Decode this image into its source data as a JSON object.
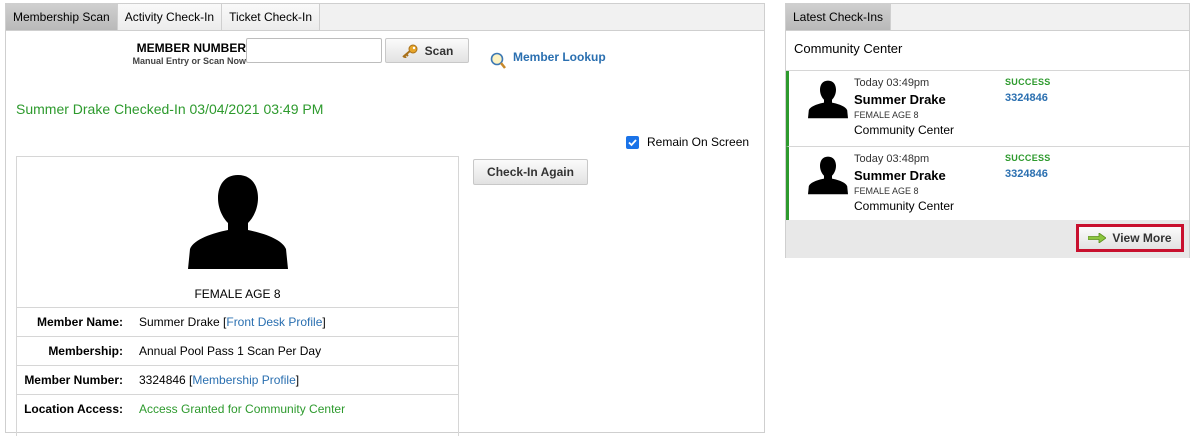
{
  "tabs": [
    "Membership Scan",
    "Activity Check-In",
    "Ticket Check-In"
  ],
  "scan_form": {
    "label": "MEMBER NUMBER",
    "sublabel": "Manual Entry or Scan Now",
    "input_value": "",
    "scan_button": "Scan",
    "lookup_link": "Member Lookup"
  },
  "checked_in_message": "Summer Drake Checked-In 03/04/2021 03:49 PM",
  "remain_on_screen": {
    "label": "Remain On Screen",
    "checked": true
  },
  "checkin_again_button": "Check-In Again",
  "member_card": {
    "age_label": "FEMALE AGE 8",
    "rows": [
      {
        "key": "Member Name:",
        "value": "Summer Drake [",
        "link": "Front Desk Profile",
        "suffix": "]"
      },
      {
        "key": "Membership:",
        "value": "Annual Pool Pass 1 Scan Per Day"
      },
      {
        "key": "Member Number:",
        "value": "3324846 [",
        "link": "Membership Profile",
        "suffix": "]"
      },
      {
        "key": "Location Access:",
        "value": "Access Granted for Community Center"
      }
    ]
  },
  "latest": {
    "tab": "Latest Check-Ins",
    "location": "Community Center",
    "entries": [
      {
        "time": "Today 03:49pm",
        "name": "Summer Drake",
        "demo": "FEMALE AGE 8",
        "location": "Community Center",
        "status": "SUCCESS",
        "number": "3324846"
      },
      {
        "time": "Today 03:48pm",
        "name": "Summer Drake",
        "demo": "FEMALE AGE 8",
        "location": "Community Center",
        "status": "SUCCESS",
        "number": "3324846"
      }
    ],
    "view_more": "View More"
  },
  "colors": {
    "success_green": "#2d9a2d",
    "link_blue": "#2a6fb0",
    "highlight_red": "#c8102e",
    "checkbox_blue": "#1a73e8"
  },
  "icons": {
    "scan": "key-icon",
    "lookup": "magnifier-icon",
    "view_more": "arrow-right-icon",
    "member_photo": "person-silhouette-icon"
  }
}
